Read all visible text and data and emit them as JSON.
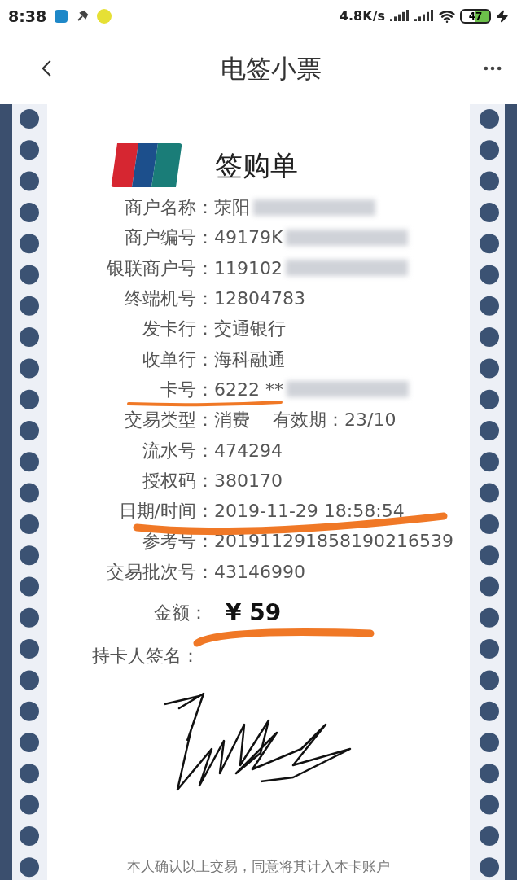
{
  "status_bar": {
    "time": "8:38",
    "speed": "4.8K/s",
    "battery": "47",
    "charging": true
  },
  "header": {
    "title": "电签小票"
  },
  "receipt": {
    "title": "签购单",
    "fields": [
      {
        "label": "商户名称：",
        "value": "荥阳",
        "redacted": true
      },
      {
        "label": "商户编号：",
        "value": "49179K",
        "redacted": true
      },
      {
        "label": "银联商户号：",
        "value": "119102",
        "redacted": true
      },
      {
        "label": "终端机号：",
        "value": "12804783"
      },
      {
        "label": "发卡行：",
        "value": "交通银行"
      },
      {
        "label": "收单行：",
        "value": "海科融通"
      },
      {
        "label": "卡号：",
        "value": "6222 **",
        "redacted": true
      },
      {
        "label": "交易类型：",
        "value": "消费",
        "extra_label": "有效期：",
        "extra_value": "23/10"
      },
      {
        "label": "流水号：",
        "value": "474294"
      },
      {
        "label": "授权码：",
        "value": "380170"
      },
      {
        "label": "日期/时间：",
        "value": "2019-11-29 18:58:54"
      },
      {
        "label": "参考号：",
        "value": "201911291858190216539"
      },
      {
        "label": "交易批次号：",
        "value": "43146990"
      }
    ],
    "amount": {
      "label": "金额：",
      "value": "¥ 59"
    },
    "signature_label": "持卡人签名：",
    "footer_note": "本人确认以上交易，同意将其计入本卡账户"
  }
}
